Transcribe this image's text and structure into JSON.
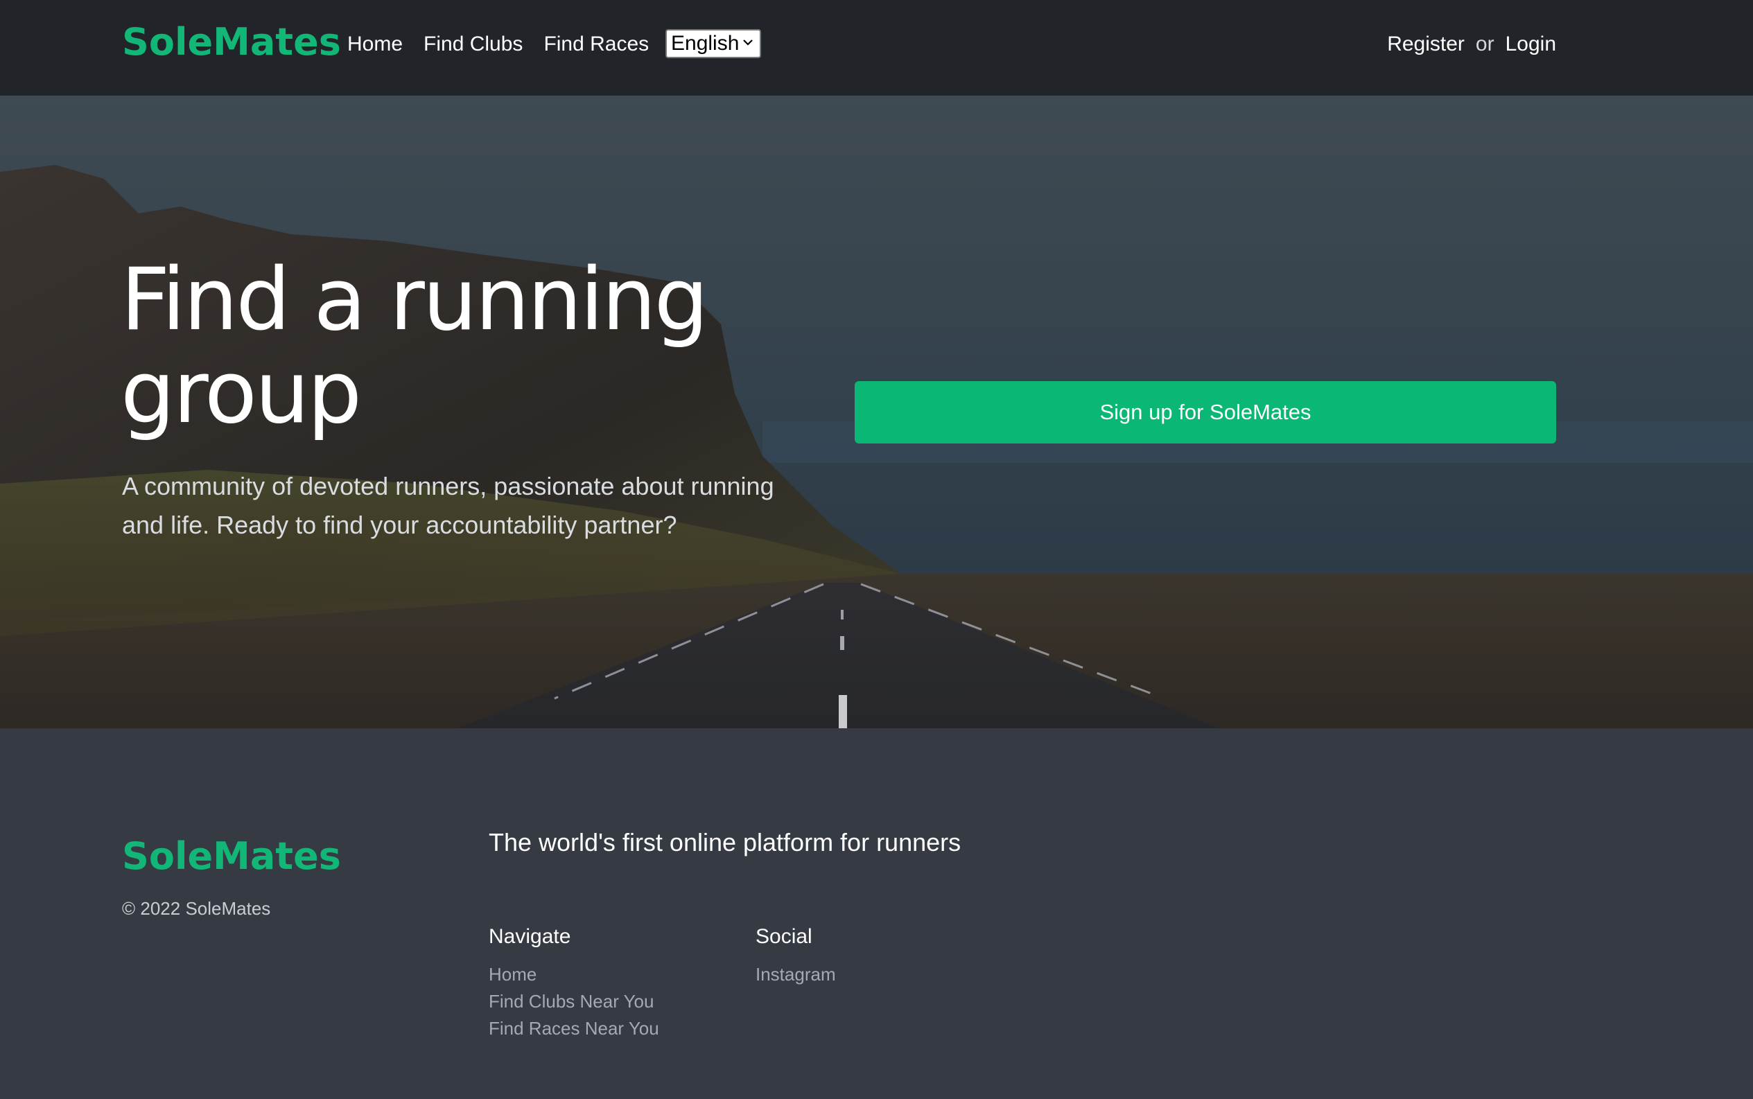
{
  "header": {
    "brand": "SoleMates",
    "nav": [
      "Home",
      "Find Clubs",
      "Find Races"
    ],
    "language": "English",
    "register_label": "Register",
    "or_label": "or",
    "login_label": "Login"
  },
  "hero": {
    "title": "Find a running group",
    "subtitle": "A community of devoted runners, passionate about running and life. Ready to find your accountability partner?",
    "cta_label": "Sign up for SoleMates"
  },
  "footer": {
    "brand": "SoleMates",
    "copyright": "© 2022 SoleMates",
    "tagline": "The world's first online platform for runners",
    "navigate_heading": "Navigate",
    "navigate_links": [
      "Home",
      "Find Clubs Near You",
      "Find Races Near You"
    ],
    "social_heading": "Social",
    "social_links": [
      "Instagram"
    ]
  },
  "colors": {
    "brand_green": "#12b777",
    "button_green": "#0bb775",
    "navbar_bg": "#212429",
    "footer_bg": "#353a43"
  },
  "icons": {
    "language_dropdown": "chevron-down-icon"
  }
}
